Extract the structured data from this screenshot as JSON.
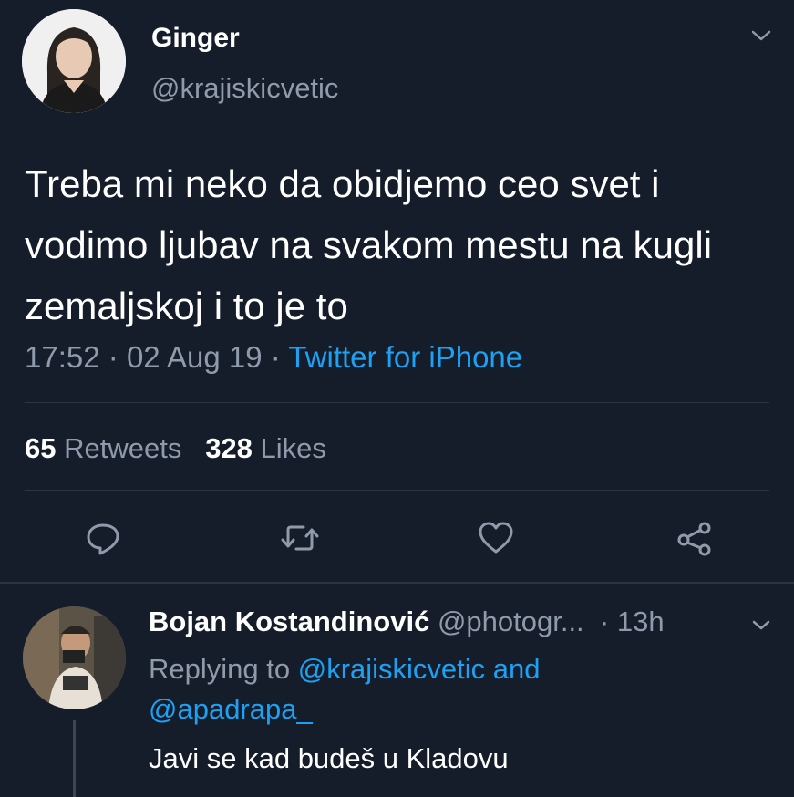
{
  "tweet": {
    "author_name": "Ginger",
    "author_handle": "@krajiskicvetic",
    "text": "Treba mi neko da obidjemo ceo svet i vodimo ljubav na svakom mestu na kugli zemaljskoj i to je to",
    "time": "17:52",
    "date": "02 Aug 19",
    "separator": "·",
    "source": "Twitter for iPhone",
    "retweets_count": "65",
    "retweets_label": "Retweets",
    "likes_count": "328",
    "likes_label": "Likes"
  },
  "reply": {
    "author_name": "Bojan Kostandinović",
    "author_handle": "@photogr...",
    "time": "13h",
    "separator": "·",
    "replying_to_label": "Replying to",
    "mention_1": "@krajiskicvetic",
    "and_label": "and",
    "mention_2": "@apadrapa_",
    "text": "Javi se kad budeš u Kladovu"
  },
  "icons": [
    "chevron-down-icon",
    "reply-icon",
    "retweet-icon",
    "like-icon",
    "share-icon"
  ],
  "colors": {
    "background": "#151c2a",
    "text_primary": "#ffffff",
    "text_secondary": "#8f9bab",
    "link": "#1da1f2",
    "divider": "#2a3444"
  }
}
